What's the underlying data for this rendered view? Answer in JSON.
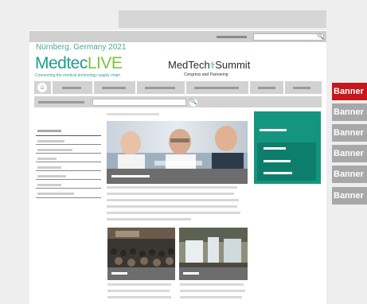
{
  "header": {
    "location": "Nürnberg, Germany 2021",
    "logo_left_main": "Medtec",
    "logo_left_accent": "LIVE",
    "logo_left_tagline": "Connecting the medical technology supply chain",
    "logo_right_main": "MedTech",
    "logo_right_accent": "Summit",
    "logo_right_tagline": "Congress and Partnering"
  },
  "icons": {
    "util_search": "🔍",
    "home": "⌂",
    "search": "🔍"
  },
  "banners": [
    {
      "label": "Banner",
      "color": "#c7161c"
    },
    {
      "label": "Banner",
      "color": "#a8a8a8"
    },
    {
      "label": "Banner",
      "color": "#a8a8a8"
    },
    {
      "label": "Banner",
      "color": "#a8a8a8"
    },
    {
      "label": "Banner",
      "color": "#a8a8a8"
    },
    {
      "label": "Banner",
      "color": "#a8a8a8"
    }
  ],
  "colors": {
    "brand_teal": "#1e9e8c",
    "brand_green": "#7fc241",
    "banner_red": "#c7161c",
    "banner_grey": "#a8a8a8"
  }
}
